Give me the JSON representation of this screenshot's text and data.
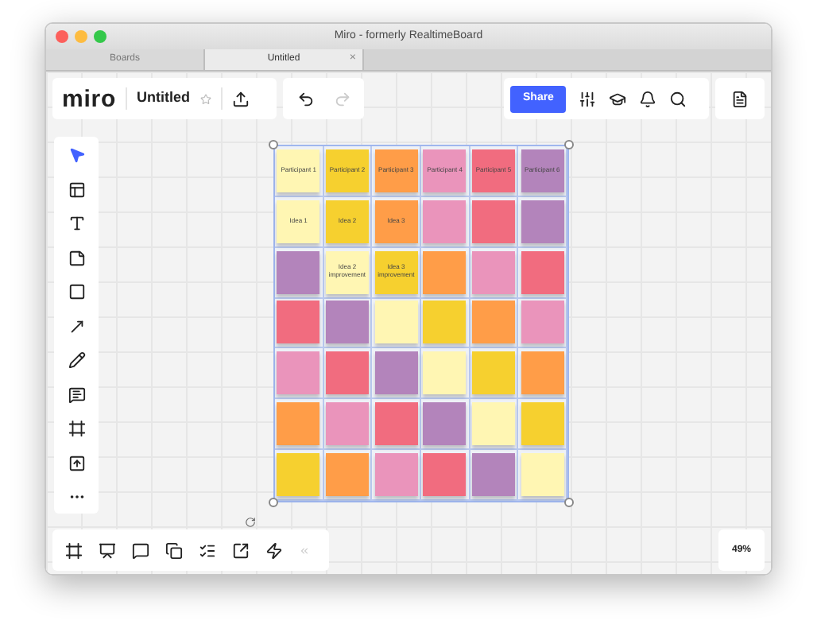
{
  "window": {
    "title": "Miro - formerly RealtimeBoard"
  },
  "tabs": [
    {
      "label": "Boards",
      "selected": false
    },
    {
      "label": "Untitled",
      "selected": true,
      "close": "×"
    }
  ],
  "topbar": {
    "logo": "miro",
    "board_name": "Untitled",
    "starred": false,
    "share": "Share",
    "redo_disabled": true
  },
  "tools": [
    {
      "kind": "pointer",
      "selected": true
    },
    {
      "kind": "templates",
      "selected": false
    },
    {
      "kind": "text",
      "selected": false
    },
    {
      "kind": "sticky",
      "selected": false
    },
    {
      "kind": "shape",
      "selected": false
    },
    {
      "kind": "arrow",
      "selected": false
    },
    {
      "kind": "pen",
      "selected": false
    },
    {
      "kind": "comment",
      "selected": false
    },
    {
      "kind": "frame",
      "selected": false
    },
    {
      "kind": "upload",
      "selected": false
    },
    {
      "kind": "more",
      "selected": false
    }
  ],
  "board": {
    "rows": [
      [
        {
          "color": "#fff6b3",
          "text": "Participant 1"
        },
        {
          "color": "#f6d02f",
          "text": "Participant 2"
        },
        {
          "color": "#ff9d48",
          "text": "Participant 3"
        },
        {
          "color": "#ea94bb",
          "text": "Participant 4"
        },
        {
          "color": "#f16c7f",
          "text": "Participant 5"
        },
        {
          "color": "#b384bb",
          "text": "Participant 6"
        }
      ],
      [
        {
          "color": "#fff6b3",
          "text": "Idea 1"
        },
        {
          "color": "#f6d02f",
          "text": "Idea 2"
        },
        {
          "color": "#ff9d48",
          "text": "Idea 3"
        },
        {
          "color": "#ea94bb"
        },
        {
          "color": "#f16c7f"
        },
        {
          "color": "#b384bb"
        }
      ],
      [
        {
          "color": "#b384bb"
        },
        {
          "color": "#fff6b3",
          "text": "Idea 2 improvement"
        },
        {
          "color": "#f6d02f",
          "text": "Idea 3 improvement"
        },
        {
          "color": "#ff9d48"
        },
        {
          "color": "#ea94bb"
        },
        {
          "color": "#f16c7f"
        }
      ],
      [
        {
          "color": "#f16c7f"
        },
        {
          "color": "#b384bb"
        },
        {
          "color": "#fff6b3"
        },
        {
          "color": "#f6d02f"
        },
        {
          "color": "#ff9d48"
        },
        {
          "color": "#ea94bb"
        }
      ],
      [
        {
          "color": "#ea94bb"
        },
        {
          "color": "#f16c7f"
        },
        {
          "color": "#b384bb"
        },
        {
          "color": "#fff6b3"
        },
        {
          "color": "#f6d02f"
        },
        {
          "color": "#ff9d48"
        }
      ],
      [
        {
          "color": "#ff9d48"
        },
        {
          "color": "#ea94bb"
        },
        {
          "color": "#f16c7f"
        },
        {
          "color": "#b384bb"
        },
        {
          "color": "#fff6b3"
        },
        {
          "color": "#f6d02f"
        }
      ],
      [
        {
          "color": "#f6d02f"
        },
        {
          "color": "#ff9d48"
        },
        {
          "color": "#ea94bb"
        },
        {
          "color": "#f16c7f"
        },
        {
          "color": "#b384bb"
        },
        {
          "color": "#fff6b3"
        }
      ]
    ]
  },
  "bottom_tools": [
    {
      "kind": "frames",
      "disabled": false
    },
    {
      "kind": "present",
      "disabled": false
    },
    {
      "kind": "chat",
      "disabled": false
    },
    {
      "kind": "screens",
      "disabled": false
    },
    {
      "kind": "cards",
      "disabled": false
    },
    {
      "kind": "share-screen",
      "disabled": false
    },
    {
      "kind": "lightning",
      "disabled": false
    },
    {
      "kind": "collapse",
      "disabled": true
    }
  ],
  "zoom": "49%"
}
